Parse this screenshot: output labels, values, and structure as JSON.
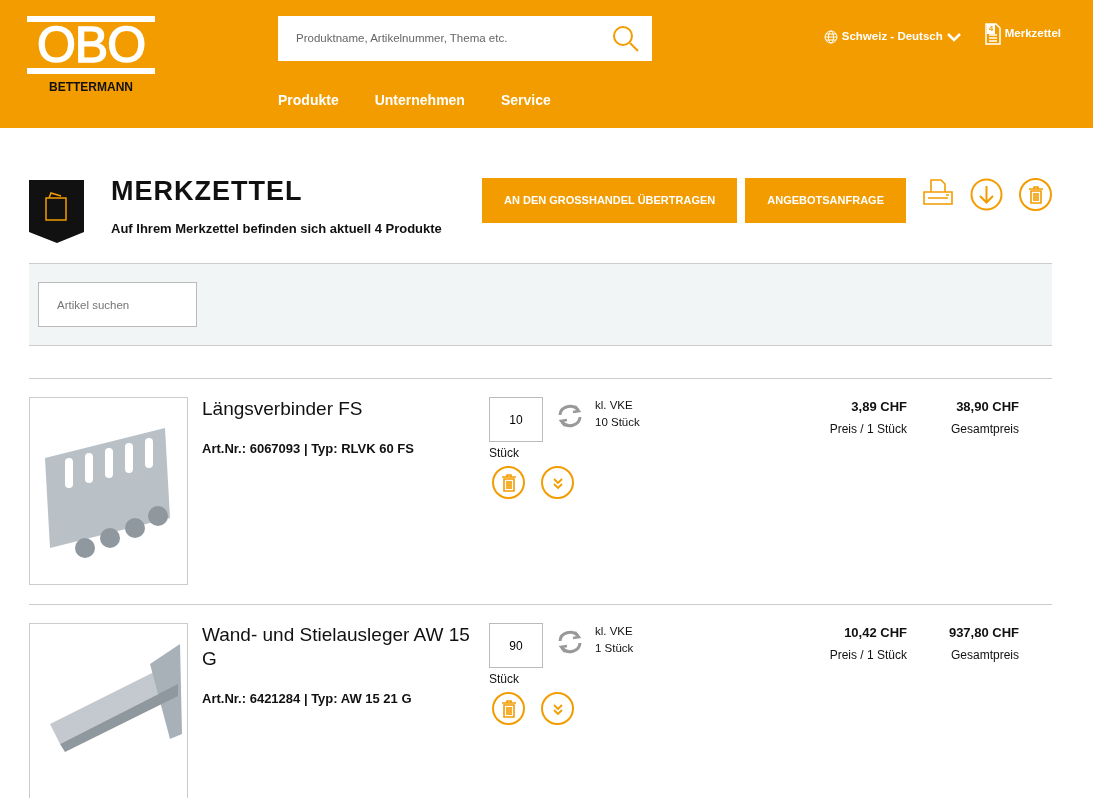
{
  "header": {
    "logo": "OBO",
    "logo_sub": "BETTERMANN",
    "search": {
      "placeholder": "Produktname, Artikelnummer, Thema etc."
    },
    "language": "Schweiz - Deutsch",
    "watchlist": {
      "label": "Merkzettel",
      "count": "4"
    },
    "nav": [
      "Produkte",
      "Unternehmen",
      "Service"
    ]
  },
  "page": {
    "title": "MERKZETTEL",
    "subtitle": "Auf Ihrem Merkzettel befinden sich aktuell 4 Produkte",
    "buttons": [
      "AN DEN GROSSHANDEL ÜBERTRAGEN",
      "ANGEBOTSANFRAGE"
    ]
  },
  "filter": {
    "placeholder": "Artikel suchen"
  },
  "products": [
    {
      "name": "Längsverbinder FS",
      "details": "Art.Nr.: 6067093 | Typ: RLVK 60 FS",
      "quantity": "10",
      "unit": "Stück",
      "vke_label": "kl. VKE",
      "vke_value": "10 Stück",
      "price": "3,89 CHF",
      "price_label": "Preis / 1 Stück",
      "total": "38,90 CHF",
      "total_label": "Gesamtpreis"
    },
    {
      "name": "Wand- und Stielausleger AW 15 G",
      "details": "Art.Nr.: 6421284 | Typ: AW 15 21 G",
      "quantity": "90",
      "unit": "Stück",
      "vke_label": "kl. VKE",
      "vke_value": "1 Stück",
      "price": "10,42 CHF",
      "price_label": "Preis / 1 Stück",
      "total": "937,80 CHF",
      "total_label": "Gesamtpreis"
    }
  ]
}
